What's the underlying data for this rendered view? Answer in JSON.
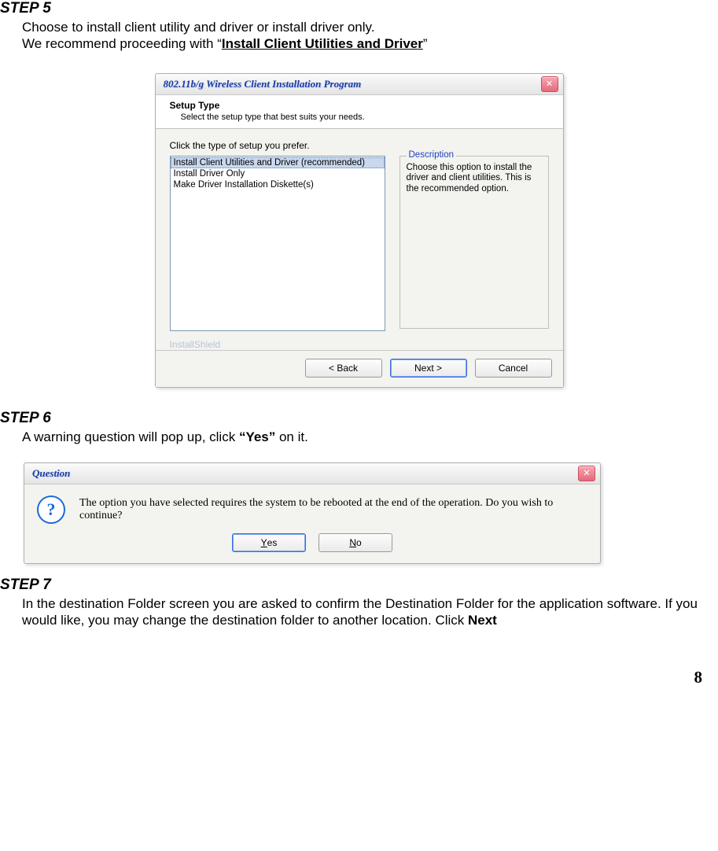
{
  "step5": {
    "heading": "STEP 5",
    "line1": "Choose to install client utility and driver or install driver only.",
    "line2_pre": "We recommend proceeding with “",
    "line2_bold": "Install Client Utilities and Driver",
    "line2_post": "”"
  },
  "dlg1": {
    "title": "802.11b/g Wireless Client Installation Program",
    "header_title": "Setup Type",
    "header_sub": "Select the setup type that best suits your needs.",
    "instruction": "Click the type of setup you prefer.",
    "options": [
      "Install Client Utilities and Driver (recommended)",
      "Install Driver Only",
      "Make Driver Installation Diskette(s)"
    ],
    "desc_legend": "Description",
    "desc_text": "Choose this option to install the driver and client utilities. This is the recommended option.",
    "brand": "InstallShield",
    "back": "< Back",
    "next": "Next >",
    "cancel": "Cancel"
  },
  "step6": {
    "heading": "STEP 6",
    "line_pre": "A warning question will pop up, click ",
    "line_bold": "“Yes”",
    "line_post": " on it."
  },
  "dlg2": {
    "title": "Question",
    "message": "The option you have selected requires the system to be rebooted at the end of the operation. Do you wish to continue?",
    "yes": "Yes",
    "no": "No"
  },
  "step7": {
    "heading": "STEP 7",
    "body_pre": "In the destination Folder screen you are asked to confirm the Destination Folder for the application software. If you would like, you may change the destination folder to another location. Click ",
    "body_bold": "Next"
  },
  "page_number": "8"
}
